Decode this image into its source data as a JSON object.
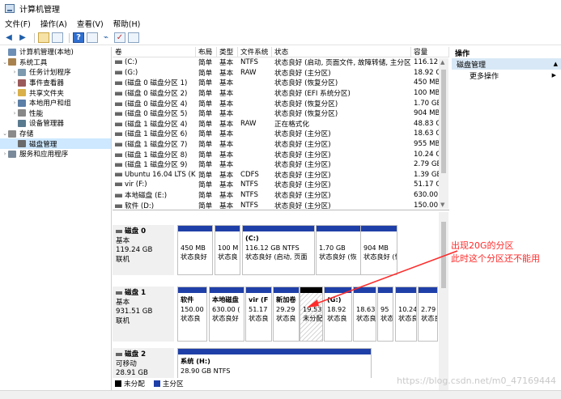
{
  "window": {
    "title": "计算机管理"
  },
  "menu": [
    "文件(F)",
    "操作(A)",
    "查看(V)",
    "帮助(H)"
  ],
  "tree": [
    {
      "label": "计算机管理(本地)",
      "chev": "",
      "icon": "computer-icon",
      "color": "#6d8fb5"
    },
    {
      "label": "系统工具",
      "chev": "⌄",
      "icon": "tools-icon",
      "color": "#a8824e"
    },
    {
      "label": "任务计划程序",
      "chev": "›",
      "icon": "clock-icon",
      "color": "#7d9aaf"
    },
    {
      "label": "事件查看器",
      "chev": "›",
      "icon": "event-viewer-icon",
      "color": "#9b5a5a"
    },
    {
      "label": "共享文件夹",
      "chev": "›",
      "icon": "shared-folder-icon",
      "color": "#d9b04a"
    },
    {
      "label": "本地用户和组",
      "chev": "›",
      "icon": "users-icon",
      "color": "#5b7fa6"
    },
    {
      "label": "性能",
      "chev": "›",
      "icon": "performance-icon",
      "color": "#888888"
    },
    {
      "label": "设备管理器",
      "chev": "",
      "icon": "device-manager-icon",
      "color": "#5a7a8f"
    },
    {
      "label": "存储",
      "chev": "⌄",
      "icon": "storage-icon",
      "color": "#8b8b8b"
    },
    {
      "label": "磁盘管理",
      "chev": "",
      "icon": "disk-management-icon",
      "color": "#6a6a6a"
    },
    {
      "label": "服务和应用程序",
      "chev": "›",
      "icon": "services-icon",
      "color": "#7a8a9a"
    }
  ],
  "volumes": {
    "headers": [
      "卷",
      "布局",
      "类型",
      "文件系统",
      "状态",
      "容量"
    ],
    "rows": [
      [
        "(C:)",
        "简单",
        "基本",
        "NTFS",
        "状态良好 (启动, 页面文件, 故障转储, 主分区)",
        "116.12 C"
      ],
      [
        "(G:)",
        "简单",
        "基本",
        "RAW",
        "状态良好 (主分区)",
        "18.92 GI"
      ],
      [
        "(磁盘 0 磁盘分区 1)",
        "简单",
        "基本",
        "",
        "状态良好 (恢复分区)",
        "450 MB"
      ],
      [
        "(磁盘 0 磁盘分区 2)",
        "简单",
        "基本",
        "",
        "状态良好 (EFI 系统分区)",
        "100 MB"
      ],
      [
        "(磁盘 0 磁盘分区 4)",
        "简单",
        "基本",
        "",
        "状态良好 (恢复分区)",
        "1.70 GB"
      ],
      [
        "(磁盘 0 磁盘分区 5)",
        "简单",
        "基本",
        "",
        "状态良好 (恢复分区)",
        "904 MB"
      ],
      [
        "(磁盘 1 磁盘分区 4)",
        "简单",
        "基本",
        "RAW",
        "正在格式化",
        "48.83 GI"
      ],
      [
        "(磁盘 1 磁盘分区 6)",
        "简单",
        "基本",
        "",
        "状态良好 (主分区)",
        "18.63 GI"
      ],
      [
        "(磁盘 1 磁盘分区 7)",
        "简单",
        "基本",
        "",
        "状态良好 (主分区)",
        "955 MB"
      ],
      [
        "(磁盘 1 磁盘分区 8)",
        "简单",
        "基本",
        "",
        "状态良好 (主分区)",
        "10.24 GI"
      ],
      [
        "(磁盘 1 磁盘分区 9)",
        "简单",
        "基本",
        "",
        "状态良好 (主分区)",
        "2.79 GB"
      ],
      [
        "Ubuntu 16.04 LTS (K:)",
        "简单",
        "基本",
        "CDFS",
        "状态良好 (主分区)",
        "1.39 GB"
      ],
      [
        "vir (F:)",
        "简单",
        "基本",
        "NTFS",
        "状态良好 (主分区)",
        "51.17 GI"
      ],
      [
        "本地磁盘 (E:)",
        "简单",
        "基本",
        "NTFS",
        "状态良好 (主分区)",
        "630.00 C"
      ],
      [
        "软件 (D:)",
        "简单",
        "基本",
        "NTFS",
        "状态良好 (主分区)",
        "150.00 C"
      ]
    ]
  },
  "disks": [
    {
      "name": "磁盘 0",
      "type": "基本",
      "size": "119.24 GB",
      "status": "联机",
      "partitions": [
        {
          "title": "",
          "line1": "450 MB",
          "line2": "状态良好",
          "color": "#1f3fa8"
        },
        {
          "title": "",
          "line1": "100 M",
          "line2": "状态良",
          "color": "#1f3fa8"
        },
        {
          "title": "(C:)",
          "line1": "116.12 GB NTFS",
          "line2": "状态良好 (启动, 页面",
          "color": "#1f3fa8"
        },
        {
          "title": "",
          "line1": "1.70 GB",
          "line2": "状态良好 (恢",
          "color": "#1f3fa8"
        },
        {
          "title": "",
          "line1": "904 MB",
          "line2": "状态良好 (恢",
          "color": "#1f3fa8"
        }
      ]
    },
    {
      "name": "磁盘 1",
      "type": "基本",
      "size": "931.51 GB",
      "status": "联机",
      "partitions": [
        {
          "title": "软件",
          "line1": "150.00",
          "line2": "状态良",
          "color": "#1f3fa8"
        },
        {
          "title": "本地磁盘",
          "line1": "630.00 (",
          "line2": "状态良好",
          "color": "#1f3fa8"
        },
        {
          "title": "vir (F",
          "line1": "51.17",
          "line2": "状态良",
          "color": "#1f3fa8"
        },
        {
          "title": "新加卷",
          "line1": "29.29",
          "line2": "状态良",
          "color": "#1f3fa8"
        },
        {
          "title": "",
          "line1": "19.53",
          "line2": "未分配",
          "color": "#000000"
        },
        {
          "title": "(G:)",
          "line1": "18.92",
          "line2": "状态良",
          "color": "#1f3fa8"
        },
        {
          "title": "",
          "line1": "18.63",
          "line2": "状态良",
          "color": "#1f3fa8"
        },
        {
          "title": "",
          "line1": "95",
          "line2": "状态",
          "color": "#1f3fa8"
        },
        {
          "title": "",
          "line1": "10.24",
          "line2": "状态良",
          "color": "#1f3fa8"
        },
        {
          "title": "",
          "line1": "2.79",
          "line2": "状态良",
          "color": "#1f3fa8"
        }
      ]
    },
    {
      "name": "磁盘 2",
      "type": "可移动",
      "size": "28.91 GB",
      "status": "",
      "partitions": [
        {
          "title": "系统 (H:)",
          "line1": "28.90 GB NTFS",
          "line2": "",
          "color": "#1f3fa8"
        }
      ]
    }
  ],
  "legend": [
    {
      "label": "未分配",
      "color": "#000000"
    },
    {
      "label": "主分区",
      "color": "#1f3fa8"
    }
  ],
  "actions": {
    "header": "操作",
    "section": "磁盘管理",
    "items": [
      "更多操作"
    ]
  },
  "annotation": {
    "line1": "出现20G的分区",
    "line2": "此时这个分区还不能用",
    "color": "#ff2a2a"
  },
  "watermark": "https://blog.csdn.net/m0_47169444"
}
